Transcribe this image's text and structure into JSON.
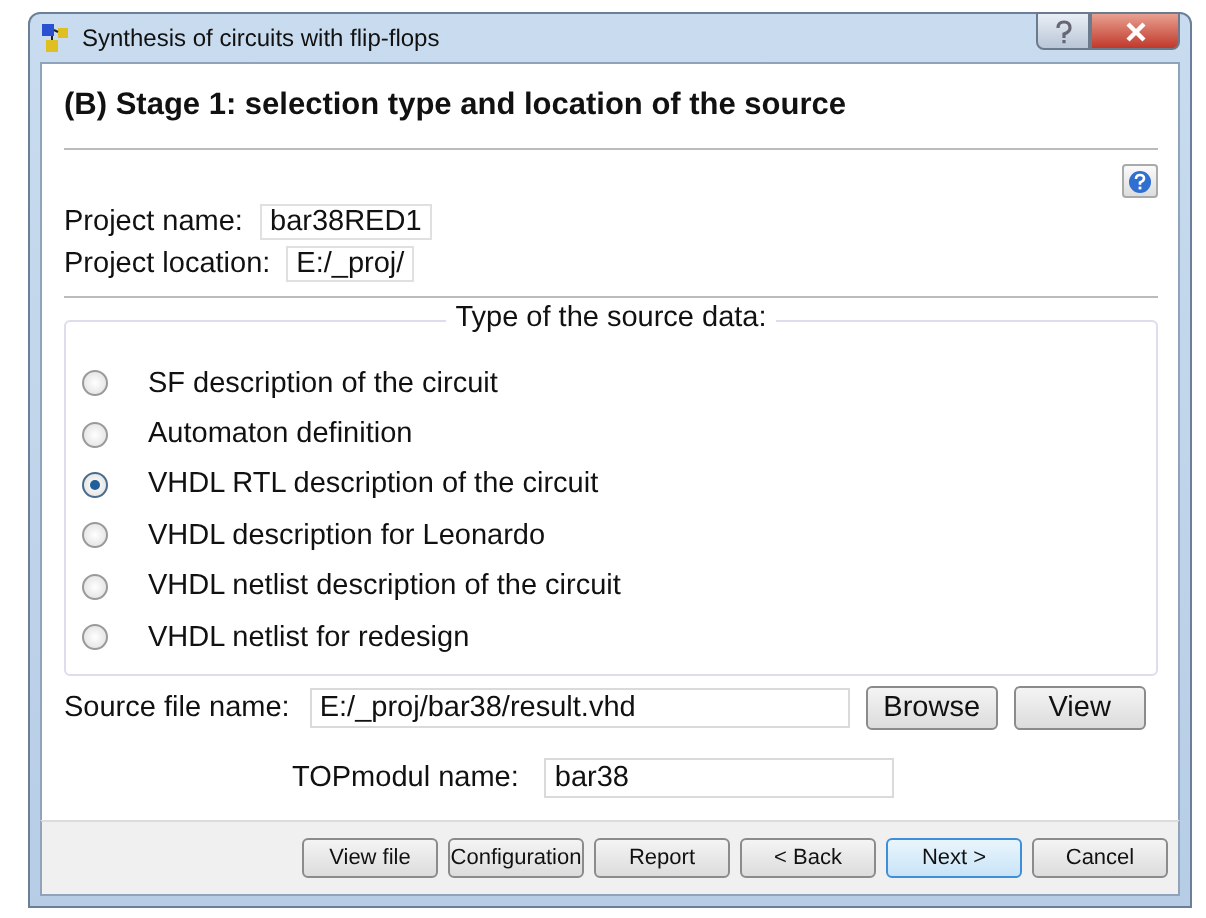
{
  "window": {
    "title": "Synthesis of circuits with flip-flops"
  },
  "heading": "(B)  Stage 1: selection type and location of the source",
  "project": {
    "name_label": "Project name:",
    "name_value": "bar38RED1",
    "location_label": "Project location:",
    "location_value": "E:/_proj/"
  },
  "source_type": {
    "title": "Type of the source data:",
    "options": [
      {
        "label": "SF description of the circuit",
        "selected": false
      },
      {
        "label": "Automaton definition",
        "selected": false
      },
      {
        "label": "VHDL RTL description of the circuit",
        "selected": true
      },
      {
        "label": "VHDL description for Leonardo",
        "selected": false
      },
      {
        "label": "VHDL netlist description of the circuit",
        "selected": false
      },
      {
        "label": "VHDL netlist for redesign",
        "selected": false
      }
    ]
  },
  "source_file": {
    "label": "Source file name:",
    "value": "E:/_proj/bar38/result.vhd",
    "buttons": [
      "Browse",
      "View"
    ]
  },
  "top_module": {
    "label": "TOPmodul name:",
    "value": "bar38"
  },
  "buttons": [
    {
      "label": "View file",
      "default": false
    },
    {
      "label": "Configuration",
      "default": false
    },
    {
      "label": "Report",
      "default": false
    },
    {
      "label": "< Back",
      "default": false
    },
    {
      "label": "Next >",
      "default": true
    },
    {
      "label": "Cancel",
      "default": false
    }
  ]
}
